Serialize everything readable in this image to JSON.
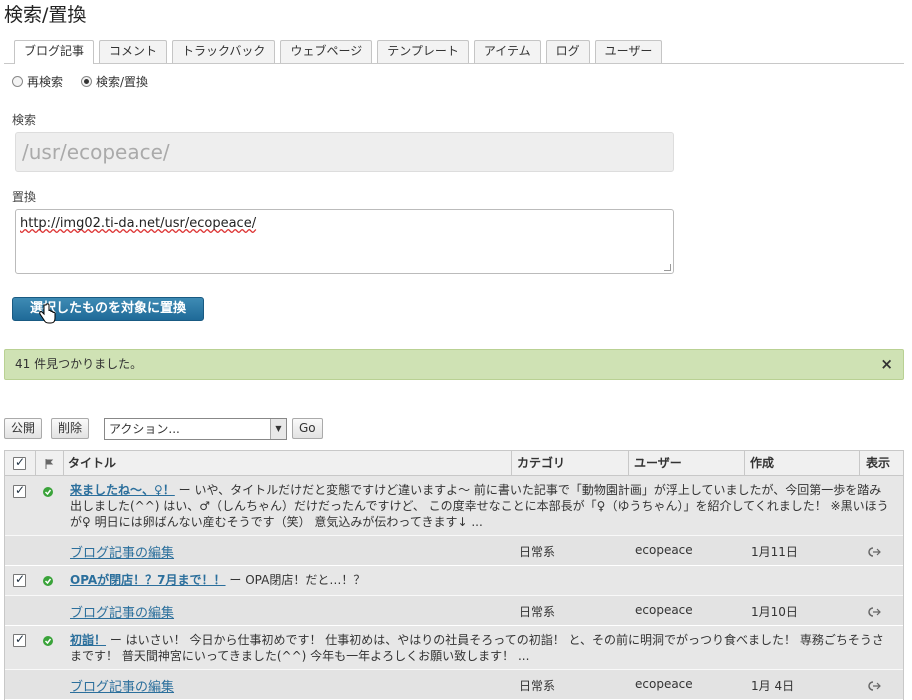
{
  "page": {
    "title": "検索/置換"
  },
  "tabs": [
    "ブログ記事",
    "コメント",
    "トラックバック",
    "ウェブページ",
    "テンプレート",
    "アイテム",
    "ログ",
    "ユーザー"
  ],
  "mode": {
    "research_label": "再検索",
    "replace_label": "検索/置換"
  },
  "search": {
    "label": "検索",
    "value": "/usr/ecopeace/"
  },
  "replace": {
    "label": "置換",
    "value": "http://img02.ti-da.net/usr/ecopeace/"
  },
  "primary_button": {
    "label": "選択したものを対象に置換"
  },
  "notice": {
    "text": "41 件見つかりました。",
    "close": "×"
  },
  "bulk": {
    "publish": "公開",
    "delete": "削除",
    "action_placeholder": "アクション...",
    "go": "Go"
  },
  "table": {
    "headers": {
      "title": "タイトル",
      "category": "カテゴリ",
      "user": "ユーザー",
      "created": "作成",
      "view": "表示"
    },
    "entries": [
      {
        "title": "来ましたね～、♀！",
        "excerpt": "ー いや、タイトルだけだと変態ですけど違いますよ～ 前に書いた記事で「動物園計画」が浮上していましたが、今回第一歩を踏み出しました(^^) はい、♂（しんちゃん）だけだったんですけど、 この度幸せなことに本部長が「♀（ゆうちゃん）」を紹介してくれました！ ※黒いほうが♀ 明日には卵ばんない産むそうです（笑） 意気込みが伝わってきます↓ ...",
        "edit_label": "ブログ記事の編集",
        "category": "日常系",
        "user": "ecopeace",
        "created": "1月11日"
      },
      {
        "title": "OPAが閉店！？7月まで！！",
        "excerpt": "ー OPA閉店！だと…！？",
        "edit_label": "ブログ記事の編集",
        "category": "日常系",
        "user": "ecopeace",
        "created": "1月10日"
      },
      {
        "title": "初詣！",
        "excerpt": "ー はいさい！ 今日から仕事初めです！ 仕事初めは、やはりの社員そろっての初詣！ と、その前に明洞でがっつり食べました！ 専務ごちそうさまです！ 普天間神宮にいってきました(^^) 今年も一年よろしくお願い致します！ ...",
        "edit_label": "ブログ記事の編集",
        "category": "日常系",
        "user": "ecopeace",
        "created": "1月 4日"
      }
    ]
  },
  "colors": {
    "accent": "#2b6f9c",
    "button": "#1f6a98",
    "notice_bg": "#cfe2b4",
    "ok": "#3aa33a"
  }
}
